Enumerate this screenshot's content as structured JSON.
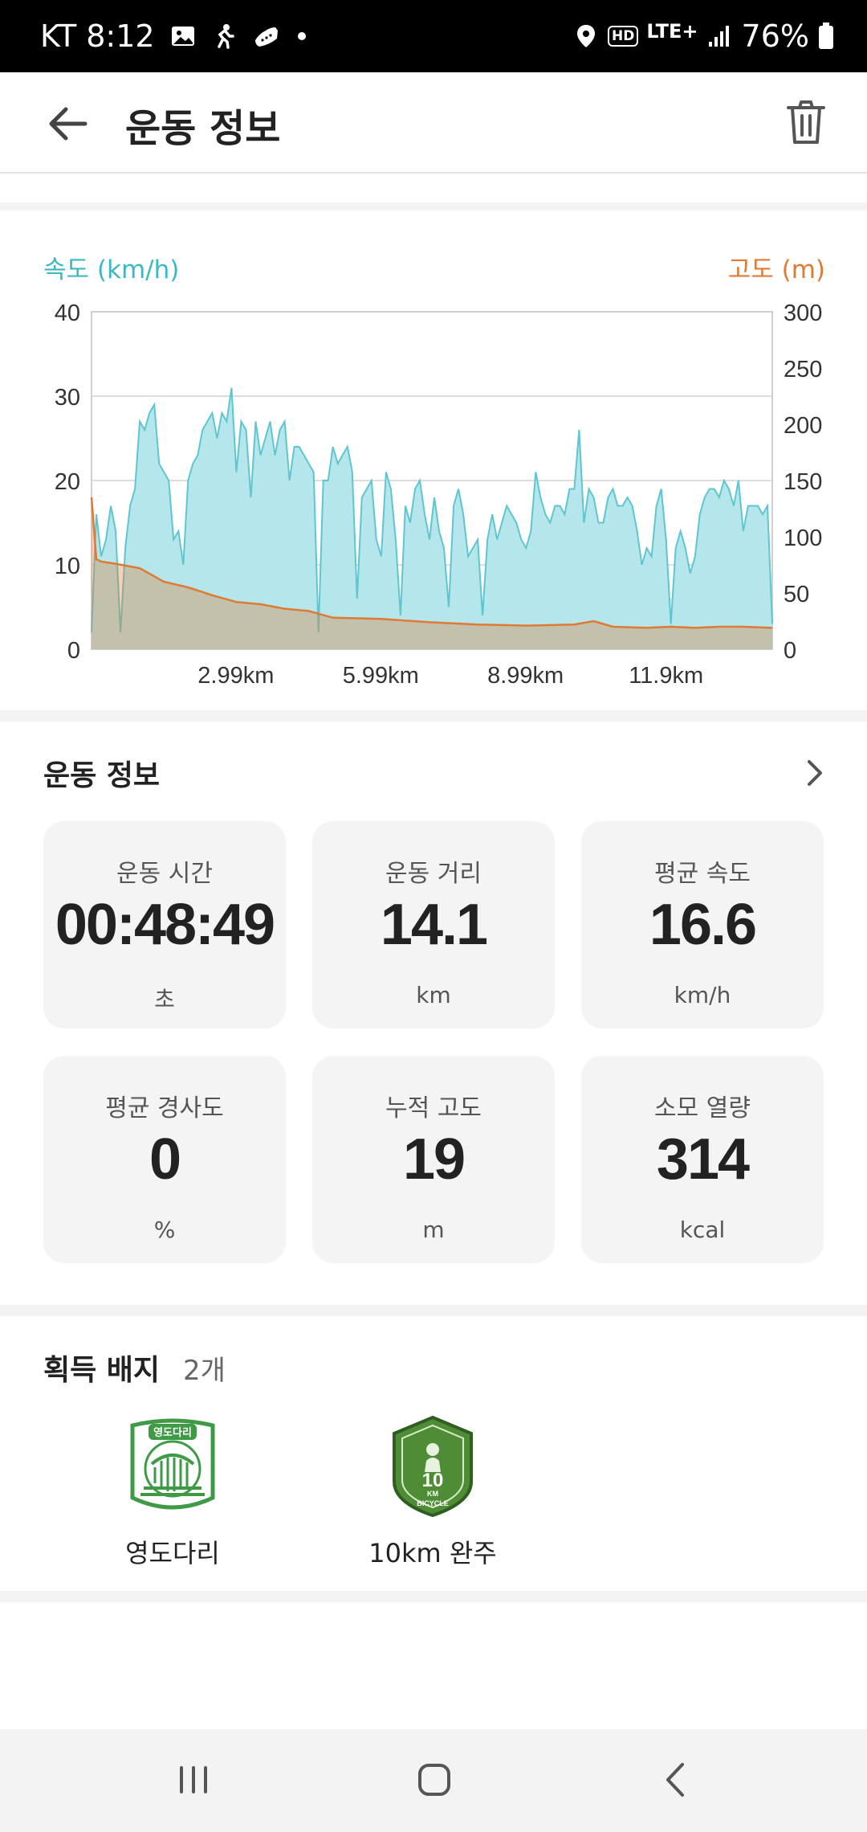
{
  "status_bar": {
    "carrier_time": "KT 8:12",
    "network_hd": "HD",
    "network_lte": "LTE+",
    "battery": "76%"
  },
  "app_bar": {
    "title": "운동 정보"
  },
  "chart": {
    "legend_left": "속도 (km/h)",
    "legend_right": "고도 (m)",
    "speed_color": "#7fd4dd",
    "altitude_color": "#e07a33"
  },
  "chart_data": {
    "type": "area",
    "x_tick_labels": [
      "2.99km",
      "5.99km",
      "8.99km",
      "11.9km"
    ],
    "x_ticks_km": [
      2.99,
      5.99,
      8.99,
      11.9
    ],
    "xlim_km": [
      0,
      14.1
    ],
    "left_axis": {
      "label": "속도 (km/h)",
      "ticks": [
        0,
        10,
        20,
        30,
        40
      ],
      "ylim": [
        0,
        40
      ]
    },
    "right_axis": {
      "label": "고도 (m)",
      "ticks": [
        0,
        50,
        100,
        150,
        200,
        250,
        300
      ],
      "ylim": [
        0,
        300
      ]
    },
    "grid": true,
    "series": [
      {
        "name": "속도 (km/h)",
        "axis": "left",
        "x": [
          0,
          0.1,
          0.2,
          0.3,
          0.4,
          0.5,
          0.6,
          0.7,
          0.8,
          0.9,
          1.0,
          1.1,
          1.2,
          1.3,
          1.4,
          1.5,
          1.6,
          1.7,
          1.8,
          1.9,
          2.0,
          2.1,
          2.2,
          2.3,
          2.4,
          2.5,
          2.6,
          2.7,
          2.8,
          2.9,
          3.0,
          3.1,
          3.2,
          3.3,
          3.4,
          3.5,
          3.6,
          3.7,
          3.8,
          3.9,
          4.0,
          4.1,
          4.2,
          4.3,
          4.4,
          4.5,
          4.6,
          4.7,
          4.8,
          4.9,
          5.0,
          5.1,
          5.2,
          5.3,
          5.4,
          5.5,
          5.6,
          5.7,
          5.8,
          5.9,
          6.0,
          6.1,
          6.2,
          6.3,
          6.4,
          6.5,
          6.6,
          6.7,
          6.8,
          6.9,
          7.0,
          7.1,
          7.2,
          7.3,
          7.4,
          7.5,
          7.6,
          7.7,
          7.8,
          7.9,
          8.0,
          8.1,
          8.2,
          8.3,
          8.4,
          8.5,
          8.6,
          8.7,
          8.8,
          8.9,
          9.0,
          9.1,
          9.2,
          9.3,
          9.4,
          9.5,
          9.6,
          9.7,
          9.8,
          9.9,
          10.0,
          10.1,
          10.2,
          10.3,
          10.4,
          10.5,
          10.6,
          10.7,
          10.8,
          10.9,
          11.0,
          11.1,
          11.2,
          11.3,
          11.4,
          11.5,
          11.6,
          11.7,
          11.8,
          11.9,
          12.0,
          12.1,
          12.2,
          12.3,
          12.4,
          12.5,
          12.6,
          12.7,
          12.8,
          12.9,
          13.0,
          13.1,
          13.2,
          13.3,
          13.4,
          13.5,
          13.6,
          13.7,
          13.8,
          13.9,
          14.0,
          14.1
        ],
        "values": [
          2,
          16,
          11,
          13,
          17,
          14,
          2,
          12,
          17,
          19,
          27,
          26,
          28,
          29,
          22,
          21,
          20,
          13,
          14,
          10,
          20,
          22,
          23,
          26,
          27,
          28,
          25,
          28,
          27,
          31,
          21,
          27,
          26,
          18,
          27,
          23,
          25,
          27,
          23,
          26,
          27,
          20,
          24,
          24,
          23,
          22,
          21,
          2,
          20,
          20,
          24,
          22,
          23,
          24,
          21,
          6,
          18,
          19,
          20,
          13,
          11,
          21,
          19,
          13,
          4,
          17,
          15,
          19,
          20,
          16,
          13,
          18,
          14,
          12,
          5,
          17,
          19,
          16,
          11,
          12,
          13,
          4,
          13,
          16,
          13,
          15,
          17,
          16,
          15,
          13,
          12,
          14,
          21,
          18,
          16,
          15,
          17,
          17,
          16,
          19,
          19,
          26,
          15,
          19,
          18,
          15,
          15,
          18,
          19,
          17,
          17,
          18,
          17,
          14,
          10,
          12,
          11,
          17,
          19,
          13,
          3,
          12,
          14,
          12,
          9,
          11,
          16,
          18,
          19,
          19,
          18,
          20,
          19,
          17,
          20,
          14,
          17,
          17,
          17,
          16,
          17,
          3
        ]
      },
      {
        "name": "고도 (m)",
        "axis": "right",
        "x": [
          0,
          0.1,
          0.2,
          0.5,
          1.0,
          1.5,
          2.0,
          2.5,
          3.0,
          3.5,
          4.0,
          4.5,
          5.0,
          6.0,
          7.0,
          8.0,
          9.0,
          10.0,
          10.4,
          10.8,
          11.5,
          12.0,
          12.5,
          13.0,
          13.5,
          14.1
        ],
        "values": [
          135,
          80,
          78,
          76,
          72,
          60,
          55,
          48,
          42,
          40,
          36,
          34,
          28,
          27,
          24,
          22,
          21,
          22,
          25,
          20,
          19,
          20,
          19,
          20,
          20,
          19
        ]
      }
    ]
  },
  "workout_section": {
    "title": "운동 정보",
    "stats": [
      {
        "label": "운동 시간",
        "value": "00:48:49",
        "unit": "초"
      },
      {
        "label": "운동 거리",
        "value": "14.1",
        "unit": "km"
      },
      {
        "label": "평균 속도",
        "value": "16.6",
        "unit": "km/h"
      },
      {
        "label": "평균 경사도",
        "value": "0",
        "unit": "%"
      },
      {
        "label": "누적 고도",
        "value": "19",
        "unit": "m"
      },
      {
        "label": "소모 열량",
        "value": "314",
        "unit": "kcal"
      }
    ]
  },
  "badges_section": {
    "title": "획득 배지",
    "count": "2개",
    "badges": [
      {
        "label": "영도다리",
        "emblem_text": "영도다리",
        "color": "#3f9a45"
      },
      {
        "label": "10km 완주",
        "emblem_text": "10",
        "emblem_unit": "KM",
        "emblem_bottom": "BICYCLE",
        "color": "#4e8c35"
      }
    ]
  }
}
